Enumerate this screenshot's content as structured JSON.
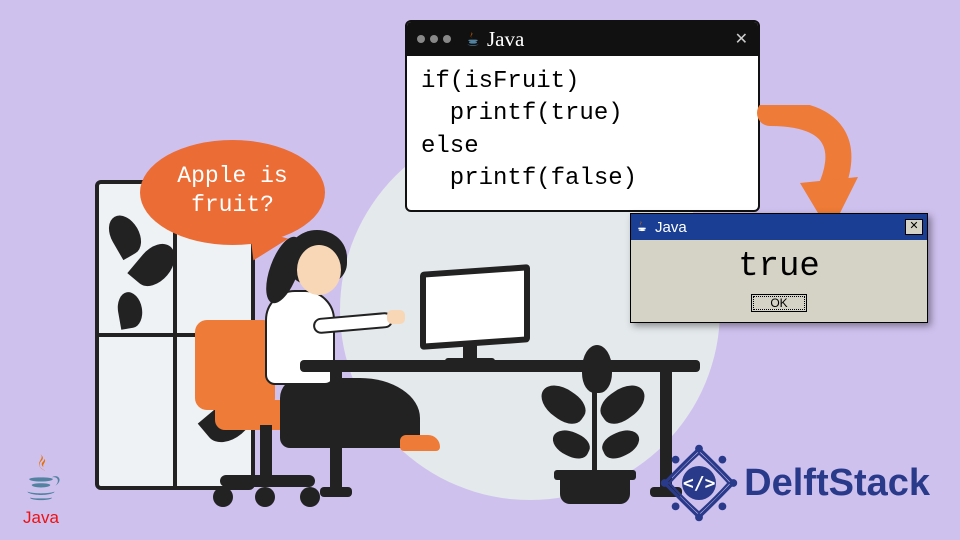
{
  "speech_bubble": "Apple is\nfruit?",
  "code_window": {
    "title": "Java",
    "lines": [
      "if(isFruit)",
      "  printf(true)",
      "else",
      "  printf(false)"
    ]
  },
  "dialog": {
    "title": "Java",
    "message": "true",
    "ok_label": "OK"
  },
  "java_logo_label": "Java",
  "delftstack_label": "DelftStack",
  "colors": {
    "accent_orange": "#eb6c34",
    "bg_lavender": "#cfc1ee",
    "dialog_titlebar": "#1a3e93",
    "delft_blue": "#2a3a8a"
  }
}
